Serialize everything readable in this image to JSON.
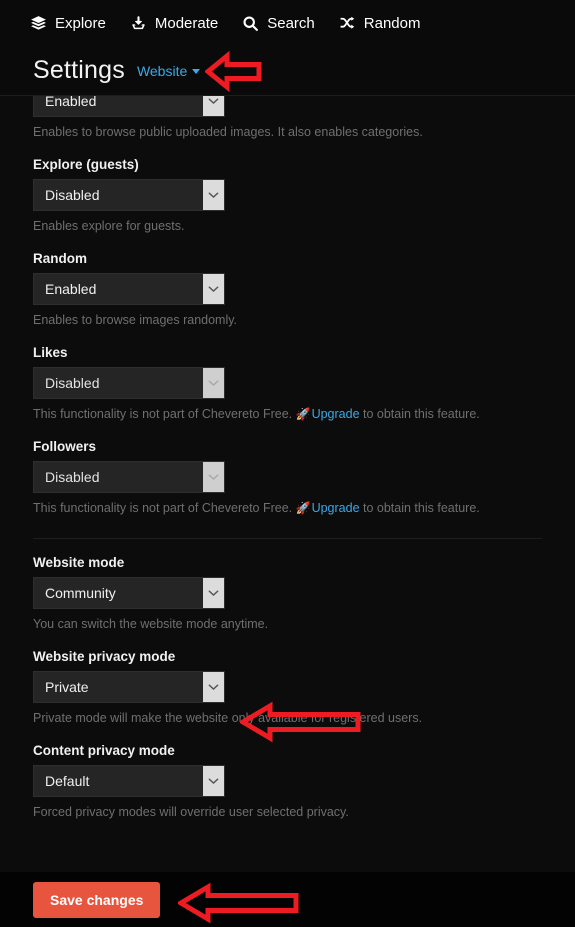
{
  "nav": {
    "items": [
      {
        "label": "Explore",
        "icon": "layers-icon"
      },
      {
        "label": "Moderate",
        "icon": "moderate-inbox-icon"
      },
      {
        "label": "Search",
        "icon": "search-icon"
      },
      {
        "label": "Random",
        "icon": "shuffle-icon"
      }
    ]
  },
  "header": {
    "title": "Settings",
    "section": "Website"
  },
  "settings": {
    "fields": [
      {
        "label": "",
        "value": "Enabled",
        "disabled": false,
        "hint_before": "Enables to browse public uploaded images. It also enables categories.",
        "link": "",
        "hint_after": ""
      },
      {
        "label": "Explore (guests)",
        "value": "Disabled",
        "disabled": false,
        "hint_before": "Enables explore for guests.",
        "link": "",
        "hint_after": ""
      },
      {
        "label": "Random",
        "value": "Enabled",
        "disabled": false,
        "hint_before": "Enables to browse images randomly.",
        "link": "",
        "hint_after": ""
      },
      {
        "label": "Likes",
        "value": "Disabled",
        "disabled": true,
        "hint_before": "This functionality is not part of Chevereto Free. ",
        "link": "Upgrade",
        "hint_after": " to obtain this feature."
      },
      {
        "label": "Followers",
        "value": "Disabled",
        "disabled": true,
        "hint_before": "This functionality is not part of Chevereto Free. ",
        "link": "Upgrade",
        "hint_after": " to obtain this feature."
      },
      {
        "label": "Website mode",
        "value": "Community",
        "disabled": false,
        "hint_before": "You can switch the website mode anytime.",
        "link": "",
        "hint_after": ""
      },
      {
        "label": "Website privacy mode",
        "value": "Private",
        "disabled": false,
        "hint_before": "Private mode will make the website only available for registered users.",
        "link": "",
        "hint_after": ""
      },
      {
        "label": "Content privacy mode",
        "value": "Default",
        "disabled": false,
        "hint_before": "Forced privacy modes will override user selected privacy.",
        "link": "",
        "hint_after": ""
      }
    ]
  },
  "footer": {
    "save_label": "Save changes"
  },
  "colors": {
    "link": "#3ba9e8",
    "save_button": "#e8553f",
    "annotation": "#ee1c22",
    "panel_bg": "#0c0c0c"
  }
}
